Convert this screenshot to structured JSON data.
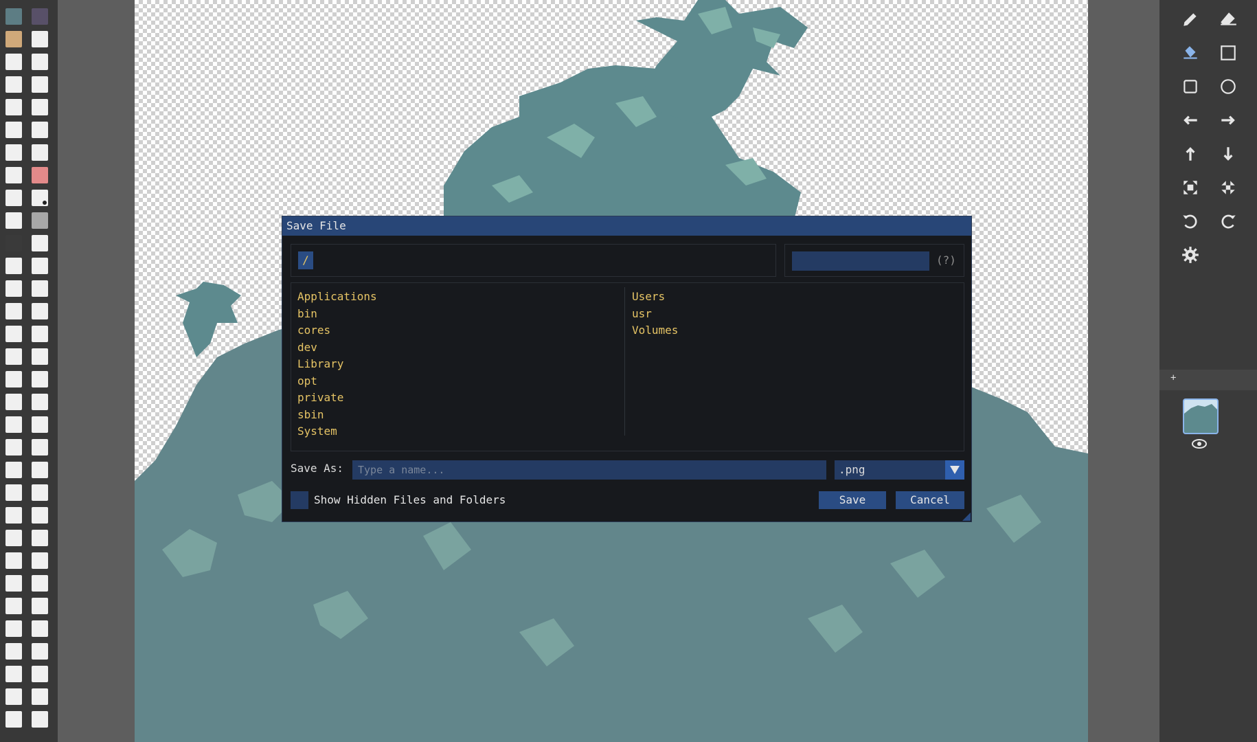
{
  "app": {
    "accent": "#284677",
    "file_text_color": "#e6c465"
  },
  "palette": {
    "colors": [
      "#5d7d84",
      "#585068",
      "#d0a97a",
      "#f0f0f0",
      "#f0f0f0",
      "#f0f0f0",
      "#f0f0f0",
      "#f0f0f0",
      "#f0f0f0",
      "#f0f0f0",
      "#f0f0f0",
      "#f0f0f0",
      "#f0f0f0",
      "#f0f0f0",
      "#f0f0f0",
      "#e38a8a",
      "#f0f0f0",
      "#f0f0f0",
      "#f0f0f0",
      "#a8a8a8",
      "#3a3a3a",
      "#f0f0f0"
    ]
  },
  "toolbar": {
    "tools": [
      {
        "icon": "pencil-icon",
        "name": "pencil-tool",
        "active": false
      },
      {
        "icon": "eraser-icon",
        "name": "eraser-tool",
        "active": false
      },
      {
        "icon": "bucket-icon",
        "name": "fill-tool",
        "active": true
      },
      {
        "icon": "selection-icon",
        "name": "select-tool",
        "active": false
      },
      {
        "icon": "rectangle-icon",
        "name": "rectangle-tool",
        "active": false
      },
      {
        "icon": "circle-icon",
        "name": "ellipse-tool",
        "active": false
      },
      {
        "icon": "arrow-left-icon",
        "name": "shift-left-tool",
        "active": false
      },
      {
        "icon": "arrow-right-icon",
        "name": "shift-right-tool",
        "active": false
      },
      {
        "icon": "arrow-up-icon",
        "name": "shift-up-tool",
        "active": false
      },
      {
        "icon": "arrow-down-icon",
        "name": "shift-down-tool",
        "active": false
      },
      {
        "icon": "expand-icon",
        "name": "zoom-in-tool",
        "active": false
      },
      {
        "icon": "compress-icon",
        "name": "zoom-out-tool",
        "active": false
      },
      {
        "icon": "undo-icon",
        "name": "undo-tool",
        "active": false
      },
      {
        "icon": "redo-icon",
        "name": "redo-tool",
        "active": false
      },
      {
        "icon": "gear-icon",
        "name": "settings-tool",
        "active": false
      }
    ],
    "layers_add": "+"
  },
  "dialog": {
    "title": "Save File",
    "path_button": "/",
    "help": "(?)",
    "files_left": [
      "Applications",
      "bin",
      "cores",
      "dev",
      "Library",
      "opt",
      "private",
      "sbin",
      "System"
    ],
    "files_right": [
      "Users",
      "usr",
      "Volumes"
    ],
    "save_as_label": "Save As:",
    "save_as_placeholder": "Type a name...",
    "extension": ".png",
    "show_hidden_label": "Show Hidden Files and Folders",
    "save_label": "Save",
    "cancel_label": "Cancel"
  }
}
